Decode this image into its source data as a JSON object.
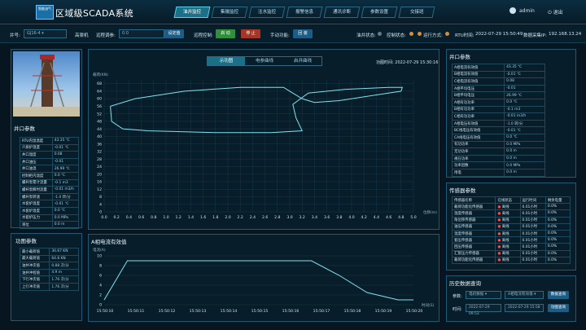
{
  "header": {
    "logo_text": "智能油气",
    "title": "区域级SCADA系统",
    "nav": [
      "油井监控",
      "集输监控",
      "注水监控",
      "报警信息",
      "通讯诊断",
      "参数设置",
      "交接班"
    ],
    "user": "admin",
    "logout": "退出"
  },
  "toolbar": {
    "well_label": "井号:",
    "well_value": "GJ16-4",
    "station": "高渠机",
    "remote_label": "远程调参:",
    "remote_value": "0.0",
    "set_btn": "设定值",
    "remote_ctrl_label": "远程控制:",
    "start_btn": "启 动",
    "stop_btn": "停 止",
    "manual_label": "手动功能:",
    "reset_btn": "回 装",
    "status_items": [
      "油井状态:",
      "控制状态:",
      "运行方式:"
    ],
    "rtu_label": "RTU时间:",
    "rtu_time": "2022-07-29 15:50:49",
    "ip_label": "数据采集IP:",
    "ip": "192.168.13.24"
  },
  "wellhead": {
    "title": "井口参数",
    "rows": [
      [
        "RTU内温温度",
        "43.35 ℃"
      ],
      [
        "介质护温度",
        "-0.01 ℃"
      ],
      [
        "井口温度",
        "0.08"
      ],
      [
        "井口油压",
        "-0.01"
      ],
      [
        "井口油温",
        "26.99 ℃"
      ],
      [
        "控制柜内温度",
        "0.0 ℃"
      ],
      [
        "螺杆泵累计流量",
        "-0.1 m3"
      ],
      [
        "螺杆泵瞬时流量",
        "-0.01 m3/h"
      ],
      [
        "螺杆泵转速",
        "-1.0 转/分"
      ],
      [
        "水套炉温度",
        "-0.01 ℃"
      ],
      [
        "水套炉温度",
        "0.0 ℃"
      ],
      [
        "水套炉压力",
        "0.0 MPa"
      ],
      [
        "液位",
        "0.0 m"
      ]
    ]
  },
  "indicator": {
    "title": "功图参数",
    "rows": [
      [
        "最小载荷值",
        "30.67 KN"
      ],
      [
        "最大载荷值",
        "64.8 KN"
      ],
      [
        "油井冲次值",
        "0.88 次/分"
      ],
      [
        "油井冲程值",
        "4.9 m"
      ],
      [
        "下行冲次值",
        "1.76 次/分"
      ],
      [
        "上行冲次值",
        "1.76 次/分"
      ]
    ]
  },
  "center": {
    "tabs": [
      "示功图",
      "电参曲线",
      "启井曲线"
    ],
    "time_label": "功图时间:",
    "time": "2022-07-29 15:30:16",
    "y_axis": "载荷(KN)",
    "x_axis": "位移(m)",
    "bottom_title": "A相电流有效值",
    "bottom_y": "电流(A)",
    "bottom_x": "时间(S)"
  },
  "chart_data": [
    {
      "type": "line",
      "title": "示功图",
      "xlabel": "位移(m)",
      "ylabel": "载荷(KN)",
      "xlim": [
        0,
        5
      ],
      "ylim": [
        0,
        70
      ],
      "x_ticks": [
        "0.0",
        "0.2",
        "0.4",
        "0.6",
        "0.8",
        "1.0",
        "1.2",
        "1.4",
        "1.6",
        "1.8",
        "2.0",
        "2.2",
        "2.4",
        "2.6",
        "2.8",
        "3.0",
        "3.2",
        "3.4",
        "3.6",
        "3.8",
        "4.0",
        "4.2",
        "4.4",
        "4.6",
        "4.8",
        "5.0"
      ],
      "y_ticks": [
        "0",
        "4",
        "8",
        "12",
        "16",
        "20",
        "24",
        "28",
        "32",
        "36",
        "40",
        "44",
        "48",
        "52",
        "56",
        "60",
        "64",
        "68"
      ],
      "x": [
        0.1,
        0.5,
        1.3,
        2.2,
        2.9,
        3.0,
        3.2,
        3.4,
        3.8,
        4.4,
        4.8,
        4.82,
        4.6,
        3.9,
        3.3,
        3.05,
        3.1,
        3.2,
        2.7,
        1.8,
        0.7,
        0.3,
        0.12,
        0.1
      ],
      "y": [
        56,
        60,
        64,
        66,
        66,
        64,
        60,
        58,
        59,
        62,
        64,
        66,
        66,
        65,
        63,
        57,
        50,
        43,
        42,
        42,
        43,
        44,
        48,
        56
      ]
    },
    {
      "type": "line",
      "title": "A相电流有效值",
      "xlabel": "时间(S)",
      "ylabel": "电流(A)",
      "ylim": [
        0,
        10
      ],
      "categories": [
        "15:50:10",
        "15:50:11",
        "15:50:12",
        "15:50:13",
        "15:50:14",
        "15:50:15",
        "15:50:16",
        "15:50:17",
        "15:50:18",
        "15:50:19",
        "15:50:20"
      ],
      "y_ticks": [
        "0",
        "2",
        "4",
        "6",
        "8",
        "10"
      ],
      "x": [
        0,
        0.75,
        2,
        3,
        4.2,
        5.5,
        6.7,
        7.6,
        8.5,
        9.5,
        10
      ],
      "y": [
        1,
        9,
        9,
        9,
        9,
        9,
        9,
        6,
        2.5,
        1,
        1
      ]
    }
  ],
  "right": {
    "title": "井口参数",
    "rows": [
      [
        "A相电流有效值",
        "43.35 ℃"
      ],
      [
        "B相电流有效值",
        "-0.01 ℃"
      ],
      [
        "C相电流有效值",
        "0.08"
      ],
      [
        "A相平均电压",
        "-0.01"
      ],
      [
        "B相平均电压",
        "26.99 ℃"
      ],
      [
        "A相有功功率",
        "0.0 ℃"
      ],
      [
        "B相有功功率",
        "-0.1 m3"
      ],
      [
        "C相有功功率",
        "-0.01 m3/h"
      ],
      [
        "A相电压有效值",
        "-1.0 转/分"
      ],
      [
        "BC线电压有效值",
        "-0.01 ℃"
      ],
      [
        "CA线电压有效值",
        "0.0 ℃"
      ],
      [
        "有功功率",
        "0.0 MPa"
      ],
      [
        "无功功率",
        "0.0 m"
      ],
      [
        "视在功率",
        "0.0 m"
      ],
      [
        "功率因数",
        "0.0 MPa"
      ],
      [
        "用电",
        "0.0 m"
      ]
    ],
    "sensor_title": "传感器参数",
    "sensor_head": [
      "传感器名称",
      "在线状态",
      "运行时间",
      "剩余电量"
    ],
    "sensors": [
      [
        "载荷功能化传感器",
        "离线",
        "0.01小时",
        "0.0%"
      ],
      [
        "温度传感器",
        "离线",
        "0.01小时",
        "0.0%"
      ],
      [
        "角位移传感器",
        "离线",
        "0.01小时",
        "0.0%"
      ],
      [
        "油压传感器",
        "离线",
        "0.01小时",
        "0.0%"
      ],
      [
        "温度传感器",
        "离线",
        "0.01小时",
        "0.0%"
      ],
      [
        "套压传感器",
        "离线",
        "0.01小时",
        "0.0%"
      ],
      [
        "回压传感器",
        "离线",
        "0.01小时",
        "0.0%"
      ],
      [
        "汇管压力传感器",
        "离线",
        "0.01小时",
        "0.0%"
      ],
      [
        "载荷功能化传感器",
        "离线",
        "0.01小时",
        "0.0%"
      ]
    ],
    "history_title": "历史数据查询",
    "param_label": "参数:",
    "param_sel": "电机数据",
    "param_sel2": "A相电流有效值",
    "query_btn": "数据查询",
    "time_label": "时间:",
    "t1": "2022-07-29 09:53",
    "t2": "2022-07-29 15:58",
    "chart_btn": "功图查询"
  }
}
